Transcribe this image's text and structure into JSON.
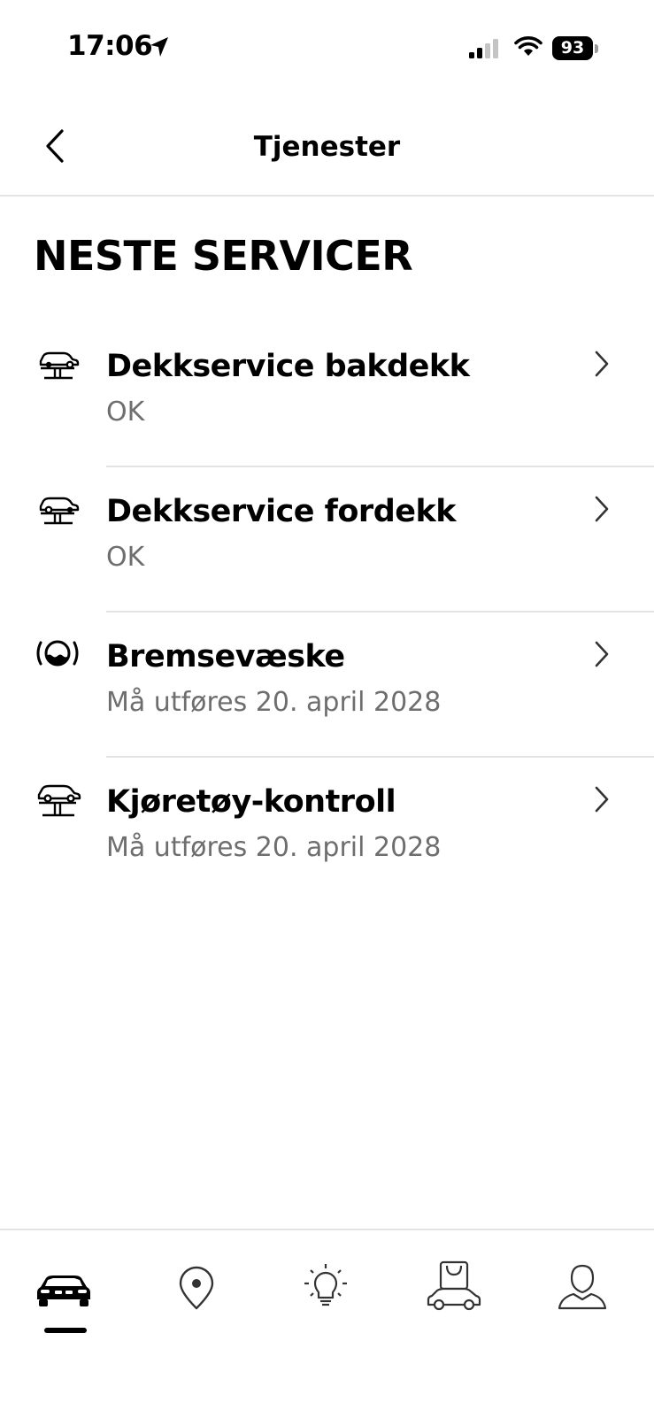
{
  "status_bar": {
    "time": "17:06",
    "battery": "93",
    "icons": [
      "location-arrow-icon",
      "cellular-signal-icon",
      "wifi-icon",
      "battery-icon"
    ]
  },
  "header": {
    "title": "Tjenester",
    "back_icon": "chevron-left-icon"
  },
  "section": {
    "title": "NESTE SERVICER"
  },
  "services": [
    {
      "title": "Dekkservice bakdekk",
      "status": "OK",
      "icon": "car-lift-rear-tire-icon"
    },
    {
      "title": "Dekkservice fordekk",
      "status": "OK",
      "icon": "car-lift-front-tire-icon"
    },
    {
      "title": "Bremsevæske",
      "status": "Må utføres 20. april 2028",
      "icon": "brake-fluid-icon"
    },
    {
      "title": "Kjøretøy-kontroll",
      "status": "Må utføres 20. april 2028",
      "icon": "car-lift-inspection-icon"
    }
  ],
  "tab_bar": {
    "tabs": [
      {
        "icon": "car-icon",
        "active": true
      },
      {
        "icon": "map-pin-icon",
        "active": false
      },
      {
        "icon": "lightbulb-icon",
        "active": false
      },
      {
        "icon": "shop-icon",
        "active": false
      },
      {
        "icon": "profile-icon",
        "active": false
      }
    ]
  }
}
